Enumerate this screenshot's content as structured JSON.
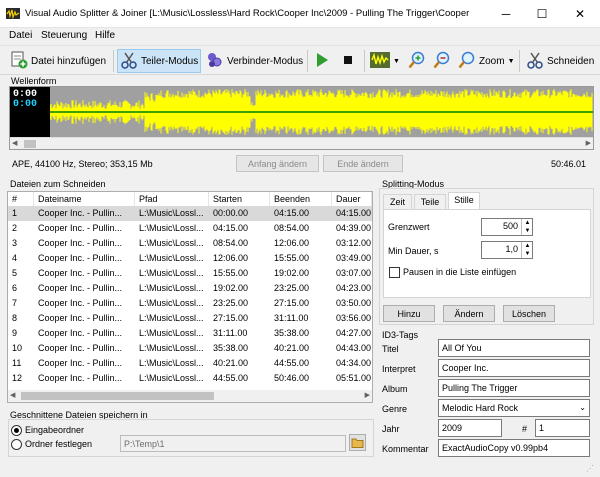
{
  "window": {
    "title": "Visual Audio Splitter & Joiner [L:\\Music\\Lossless\\Hard Rock\\Cooper Inc\\2009 - Pulling The Trigger\\Cooper",
    "minimize": "─",
    "maximize": "☐",
    "close": "✕"
  },
  "menu": [
    "Datei",
    "Steuerung",
    "Hilfe"
  ],
  "toolbar": {
    "add_files": "Datei hinzufügen",
    "split_mode": "Teiler-Modus",
    "join_mode": "Verbinder-Modus",
    "zoom": "Zoom",
    "cut": "Schneiden"
  },
  "waveform": {
    "label": "Wellenform",
    "time_top": "0:00",
    "time_bottom": "0:00",
    "info": "APE, 44100 Hz, Stereo; 353,15 Mb",
    "change_start": "Anfang ändern",
    "change_end": "Ende ändern",
    "total_time": "50:46.01",
    "colors": {
      "background": "#a0a0a0",
      "wave": "#ffff00",
      "line": "#008000"
    }
  },
  "files": {
    "label": "Dateien zum Schneiden",
    "columns": [
      "#",
      "Dateiname",
      "Pfad",
      "Starten",
      "Beenden",
      "Dauer"
    ],
    "rows": [
      [
        "1",
        "Cooper Inc. - Pullin...",
        "L:\\Music\\Lossl...",
        "00:00.00",
        "04:15.00",
        "04:15.00"
      ],
      [
        "2",
        "Cooper Inc. - Pullin...",
        "L:\\Music\\Lossl...",
        "04:15.00",
        "08:54.00",
        "04:39.00"
      ],
      [
        "3",
        "Cooper Inc. - Pullin...",
        "L:\\Music\\Lossl...",
        "08:54.00",
        "12:06.00",
        "03:12.00"
      ],
      [
        "4",
        "Cooper Inc. - Pullin...",
        "L:\\Music\\Lossl...",
        "12:06.00",
        "15:55.00",
        "03:49.00"
      ],
      [
        "5",
        "Cooper Inc. - Pullin...",
        "L:\\Music\\Lossl...",
        "15:55.00",
        "19:02.00",
        "03:07.00"
      ],
      [
        "6",
        "Cooper Inc. - Pullin...",
        "L:\\Music\\Lossl...",
        "19:02.00",
        "23:25.00",
        "04:23.00"
      ],
      [
        "7",
        "Cooper Inc. - Pullin...",
        "L:\\Music\\Lossl...",
        "23:25.00",
        "27:15.00",
        "03:50.00"
      ],
      [
        "8",
        "Cooper Inc. - Pullin...",
        "L:\\Music\\Lossl...",
        "27:15.00",
        "31:11.00",
        "03:56.00"
      ],
      [
        "9",
        "Cooper Inc. - Pullin...",
        "L:\\Music\\Lossl...",
        "31:11.00",
        "35:38.00",
        "04:27.00"
      ],
      [
        "10",
        "Cooper Inc. - Pullin...",
        "L:\\Music\\Lossl...",
        "35:38.00",
        "40:21.00",
        "04:43.00"
      ],
      [
        "11",
        "Cooper Inc. - Pullin...",
        "L:\\Music\\Lossl...",
        "40:21.00",
        "44:55.00",
        "04:34.00"
      ],
      [
        "12",
        "Cooper Inc. - Pullin...",
        "L:\\Music\\Lossl...",
        "44:55.00",
        "50:46.00",
        "05:51.00"
      ]
    ]
  },
  "splitting": {
    "label": "Splitting-Modus",
    "tabs": [
      "Zeit",
      "Teile",
      "Stille"
    ],
    "active_tab": 2,
    "threshold_label": "Grenzwert",
    "threshold_value": "500",
    "min_duration_label": "Min Dauer, s",
    "min_duration_value": "1,0",
    "pauses_label": "Pausen in die Liste einfügen",
    "add": "Hinzu",
    "change": "Ändern",
    "delete": "Löschen"
  },
  "id3": {
    "label": "ID3-Tags",
    "title_label": "Titel",
    "title_value": "All Of You",
    "artist_label": "Interpret",
    "artist_value": "Cooper Inc.",
    "album_label": "Album",
    "album_value": "Pulling The Trigger",
    "genre_label": "Genre",
    "genre_value": "Melodic Hard Rock",
    "year_label": "Jahr",
    "year_value": "2009",
    "track_label": "#",
    "track_value": "1",
    "comment_label": "Kommentar",
    "comment_value": "ExactAudioCopy v0.99pb4"
  },
  "save": {
    "label": "Geschnittene Dateien speichern in",
    "input_folder": "Eingabeordner",
    "fixed_folder": "Ordner festlegen",
    "path": "P:\\Temp\\1"
  }
}
